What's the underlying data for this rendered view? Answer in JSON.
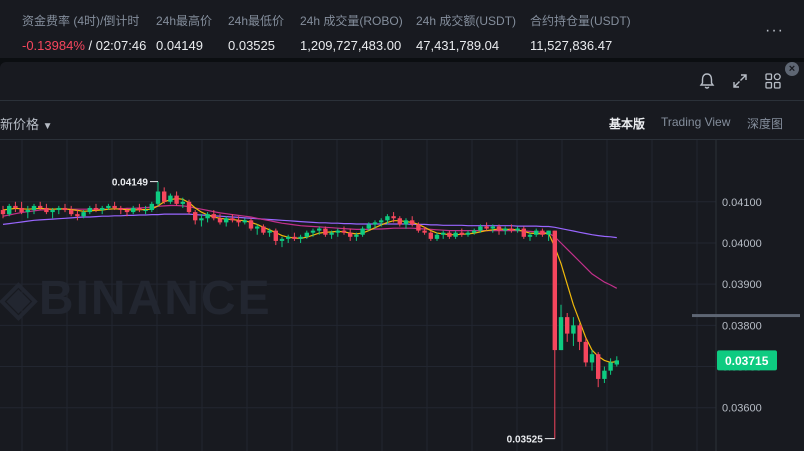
{
  "stats": [
    {
      "label": "资金费率 (4时)/倒计时",
      "value_part1": "-0.13984%",
      "value_part2": " / 02:07:46"
    },
    {
      "label": "24h最高价",
      "value": "0.04149"
    },
    {
      "label": "24h最低价",
      "value": "0.03525"
    },
    {
      "label": "24h 成交量(ROBO)",
      "value": "1,209,727,483.00"
    },
    {
      "label": "24h 成交额(USDT)",
      "value": "47,431,789.04"
    },
    {
      "label": "合约持仓量(USDT)",
      "value": "11,527,836.47"
    }
  ],
  "more_label": "···",
  "price_selector": "新价格",
  "view_tabs": [
    "基本版",
    "Trading View",
    "深度图"
  ],
  "watermark": "BINANCE",
  "chart_data": {
    "type": "candlestick",
    "y_ticks": [
      "0.04100",
      "0.04000",
      "0.03900",
      "0.03800",
      "0.03700",
      "0.03600"
    ],
    "y_tick_values": [
      0.041,
      0.04,
      0.039,
      0.038,
      0.037,
      0.036
    ],
    "ylim": [
      0.03495,
      0.0425
    ],
    "current_price": "0.03715",
    "high_label": "0.04149",
    "low_label": "0.03525",
    "colors": {
      "up": "#0ecb81",
      "down": "#f6465d",
      "ma_fast": "#f0b90b",
      "ma_mid": "#c2308b",
      "ma_slow": "#9966ff",
      "price_tag": "#0ecb81"
    },
    "candles": [
      [
        0.0408,
        0.0409,
        0.0406,
        0.0407
      ],
      [
        0.0407,
        0.04095,
        0.04065,
        0.0409
      ],
      [
        0.0409,
        0.041,
        0.04075,
        0.04085
      ],
      [
        0.04085,
        0.041,
        0.0407,
        0.04075
      ],
      [
        0.04075,
        0.0409,
        0.0406,
        0.0408
      ],
      [
        0.0408,
        0.04095,
        0.0407,
        0.0409
      ],
      [
        0.0409,
        0.041,
        0.0408,
        0.04085
      ],
      [
        0.04085,
        0.04095,
        0.0407,
        0.04075
      ],
      [
        0.04075,
        0.04085,
        0.0406,
        0.0408
      ],
      [
        0.0408,
        0.0409,
        0.0407,
        0.04085
      ],
      [
        0.04085,
        0.04095,
        0.04075,
        0.0408
      ],
      [
        0.0408,
        0.0409,
        0.04065,
        0.0407
      ],
      [
        0.0407,
        0.0408,
        0.04055,
        0.04065
      ],
      [
        0.04065,
        0.0408,
        0.0406,
        0.04075
      ],
      [
        0.04075,
        0.0409,
        0.0407,
        0.04085
      ],
      [
        0.04085,
        0.04095,
        0.04075,
        0.0408
      ],
      [
        0.0408,
        0.0409,
        0.0407,
        0.04085
      ],
      [
        0.04085,
        0.04095,
        0.0408,
        0.0409
      ],
      [
        0.0409,
        0.041,
        0.0408,
        0.04085
      ],
      [
        0.04085,
        0.0409,
        0.0407,
        0.0408
      ],
      [
        0.0408,
        0.04085,
        0.04065,
        0.04075
      ],
      [
        0.04075,
        0.0409,
        0.0407,
        0.04085
      ],
      [
        0.04085,
        0.04095,
        0.04075,
        0.0408
      ],
      [
        0.0408,
        0.0409,
        0.0407,
        0.0408
      ],
      [
        0.0408,
        0.041,
        0.04075,
        0.04095
      ],
      [
        0.04095,
        0.04149,
        0.0409,
        0.04125
      ],
      [
        0.04125,
        0.04135,
        0.04095,
        0.041
      ],
      [
        0.041,
        0.0412,
        0.04095,
        0.04115
      ],
      [
        0.04115,
        0.04125,
        0.0409,
        0.04095
      ],
      [
        0.04095,
        0.0411,
        0.04085,
        0.041
      ],
      [
        0.041,
        0.04105,
        0.0407,
        0.04075
      ],
      [
        0.04075,
        0.0408,
        0.04045,
        0.04055
      ],
      [
        0.04055,
        0.0407,
        0.0404,
        0.0406
      ],
      [
        0.0406,
        0.04075,
        0.0405,
        0.0407
      ],
      [
        0.0407,
        0.0408,
        0.04055,
        0.0406
      ],
      [
        0.0406,
        0.0407,
        0.04045,
        0.0405
      ],
      [
        0.0405,
        0.04065,
        0.0404,
        0.0406
      ],
      [
        0.0406,
        0.0407,
        0.0405,
        0.04055
      ],
      [
        0.04055,
        0.04065,
        0.0404,
        0.0405
      ],
      [
        0.0405,
        0.0406,
        0.04045,
        0.04055
      ],
      [
        0.04055,
        0.0406,
        0.0403,
        0.04035
      ],
      [
        0.04035,
        0.04045,
        0.0402,
        0.0404
      ],
      [
        0.0404,
        0.04045,
        0.0402,
        0.04025
      ],
      [
        0.04025,
        0.04035,
        0.04015,
        0.0403
      ],
      [
        0.0403,
        0.04035,
        0.03995,
        0.04005
      ],
      [
        0.04005,
        0.04015,
        0.0399,
        0.0401
      ],
      [
        0.0401,
        0.0402,
        0.04,
        0.04015
      ],
      [
        0.04015,
        0.04025,
        0.04005,
        0.0401
      ],
      [
        0.0401,
        0.0402,
        0.04,
        0.04015
      ],
      [
        0.04015,
        0.0403,
        0.0401,
        0.04025
      ],
      [
        0.04025,
        0.04035,
        0.04015,
        0.0403
      ],
      [
        0.0403,
        0.0404,
        0.0402,
        0.04035
      ],
      [
        0.04035,
        0.0404,
        0.04015,
        0.0402
      ],
      [
        0.0402,
        0.0403,
        0.0401,
        0.04025
      ],
      [
        0.04025,
        0.04035,
        0.04015,
        0.0403
      ],
      [
        0.0403,
        0.0404,
        0.0402,
        0.04025
      ],
      [
        0.04025,
        0.04035,
        0.04005,
        0.04015
      ],
      [
        0.04015,
        0.04025,
        0.04005,
        0.0402
      ],
      [
        0.0402,
        0.0404,
        0.04015,
        0.04035
      ],
      [
        0.04035,
        0.0405,
        0.0403,
        0.04045
      ],
      [
        0.04045,
        0.04055,
        0.04035,
        0.0405
      ],
      [
        0.0405,
        0.0406,
        0.0404,
        0.04055
      ],
      [
        0.04055,
        0.0407,
        0.04045,
        0.04065
      ],
      [
        0.04065,
        0.04075,
        0.0405,
        0.0406
      ],
      [
        0.0406,
        0.04065,
        0.0404,
        0.04045
      ],
      [
        0.04045,
        0.0406,
        0.04035,
        0.04055
      ],
      [
        0.04055,
        0.04065,
        0.0404,
        0.04045
      ],
      [
        0.04045,
        0.0405,
        0.04025,
        0.0403
      ],
      [
        0.0403,
        0.0404,
        0.0402,
        0.04025
      ],
      [
        0.04025,
        0.0403,
        0.04005,
        0.0401
      ],
      [
        0.0401,
        0.04025,
        0.04005,
        0.0402
      ],
      [
        0.0402,
        0.0403,
        0.0401,
        0.04025
      ],
      [
        0.04025,
        0.0403,
        0.0401,
        0.04015
      ],
      [
        0.04015,
        0.0403,
        0.0401,
        0.04025
      ],
      [
        0.04025,
        0.04035,
        0.04015,
        0.0402
      ],
      [
        0.0402,
        0.0403,
        0.04015,
        0.04025
      ],
      [
        0.04025,
        0.04035,
        0.0402,
        0.0403
      ],
      [
        0.0403,
        0.04045,
        0.04025,
        0.0404
      ],
      [
        0.0404,
        0.0405,
        0.0403,
        0.04035
      ],
      [
        0.04035,
        0.04045,
        0.04025,
        0.0404
      ],
      [
        0.0404,
        0.04045,
        0.0402,
        0.0403
      ],
      [
        0.0403,
        0.0404,
        0.0402,
        0.04035
      ],
      [
        0.04035,
        0.04045,
        0.04025,
        0.0403
      ],
      [
        0.0403,
        0.0404,
        0.04025,
        0.04035
      ],
      [
        0.04035,
        0.0404,
        0.0401,
        0.04015
      ],
      [
        0.04015,
        0.04025,
        0.04005,
        0.0402
      ],
      [
        0.0402,
        0.04035,
        0.04015,
        0.0403
      ],
      [
        0.0403,
        0.04035,
        0.04015,
        0.0402
      ],
      [
        0.0402,
        0.0403,
        0.04005,
        0.0403
      ],
      [
        0.0403,
        0.0403,
        0.03525,
        0.0374
      ],
      [
        0.0374,
        0.0385,
        0.0374,
        0.0382
      ],
      [
        0.0382,
        0.0383,
        0.0376,
        0.0378
      ],
      [
        0.0378,
        0.0382,
        0.0375,
        0.038
      ],
      [
        0.038,
        0.03805,
        0.0374,
        0.0376
      ],
      [
        0.0376,
        0.0377,
        0.037,
        0.0371
      ],
      [
        0.0371,
        0.0374,
        0.0369,
        0.0373
      ],
      [
        0.0373,
        0.03735,
        0.0365,
        0.0367
      ],
      [
        0.0367,
        0.037,
        0.0366,
        0.0369
      ],
      [
        0.0369,
        0.0372,
        0.0368,
        0.0371
      ],
      [
        0.03705,
        0.03725,
        0.037,
        0.03715
      ]
    ],
    "ma_fast": [
      0.0408,
      0.04082,
      0.04084,
      0.04083,
      0.04082,
      0.04083,
      0.04084,
      0.04083,
      0.04082,
      0.04083,
      0.04083,
      0.04081,
      0.04079,
      0.04077,
      0.04078,
      0.04079,
      0.0408,
      0.04082,
      0.04083,
      0.04082,
      0.04081,
      0.0408,
      0.04081,
      0.04081,
      0.04082,
      0.0409,
      0.041,
      0.04105,
      0.04108,
      0.04106,
      0.04098,
      0.04085,
      0.04075,
      0.04068,
      0.04063,
      0.0406,
      0.04058,
      0.04057,
      0.04055,
      0.04054,
      0.0405,
      0.04045,
      0.04038,
      0.04032,
      0.04025,
      0.04018,
      0.04014,
      0.04012,
      0.04011,
      0.04014,
      0.04019,
      0.04024,
      0.04026,
      0.04027,
      0.04028,
      0.04027,
      0.04024,
      0.04022,
      0.04024,
      0.0403,
      0.04037,
      0.04044,
      0.0405,
      0.04054,
      0.04054,
      0.04052,
      0.0405,
      0.04045,
      0.04038,
      0.0403,
      0.04024,
      0.04022,
      0.0402,
      0.0402,
      0.04021,
      0.04022,
      0.04024,
      0.04027,
      0.0403,
      0.04032,
      0.04034,
      0.04033,
      0.04033,
      0.04032,
      0.04028,
      0.04024,
      0.04023,
      0.04022,
      0.04024,
      0.0399,
      0.0395,
      0.039,
      0.0385,
      0.0381,
      0.0377,
      0.0374,
      0.03725,
      0.03715,
      0.0371,
      0.03712
    ],
    "ma_mid": [
      0.04065,
      0.04068,
      0.04071,
      0.04074,
      0.04076,
      0.04078,
      0.0408,
      0.04081,
      0.04082,
      0.04082,
      0.04082,
      0.04082,
      0.04082,
      0.04082,
      0.04082,
      0.04082,
      0.04082,
      0.04082,
      0.04083,
      0.04083,
      0.04084,
      0.04084,
      0.04085,
      0.04086,
      0.04087,
      0.04089,
      0.0409,
      0.04091,
      0.04091,
      0.0409,
      0.04088,
      0.04085,
      0.04082,
      0.04079,
      0.04076,
      0.04073,
      0.04071,
      0.04069,
      0.04067,
      0.04065,
      0.04063,
      0.0406,
      0.04057,
      0.04054,
      0.04051,
      0.04048,
      0.04046,
      0.04044,
      0.04042,
      0.04041,
      0.0404,
      0.04039,
      0.04038,
      0.04037,
      0.04036,
      0.04035,
      0.04034,
      0.04033,
      0.04033,
      0.04033,
      0.04034,
      0.04034,
      0.04035,
      0.04036,
      0.04036,
      0.04036,
      0.04036,
      0.04035,
      0.04034,
      0.04033,
      0.04032,
      0.04031,
      0.0403,
      0.0403,
      0.0403,
      0.0403,
      0.0403,
      0.0403,
      0.0403,
      0.0403,
      0.0403,
      0.0403,
      0.0403,
      0.0403,
      0.04029,
      0.04028,
      0.04027,
      0.04026,
      0.04024,
      0.04015,
      0.04,
      0.03985,
      0.0397,
      0.03955,
      0.0394,
      0.03925,
      0.03915,
      0.03905,
      0.03898,
      0.0389
    ],
    "ma_slow": [
      0.04045,
      0.04047,
      0.04049,
      0.04051,
      0.04053,
      0.04055,
      0.04056,
      0.04057,
      0.04058,
      0.04059,
      0.0406,
      0.04061,
      0.04062,
      0.04063,
      0.04063,
      0.04064,
      0.04065,
      0.04065,
      0.04066,
      0.04066,
      0.04067,
      0.04067,
      0.04068,
      0.04068,
      0.04069,
      0.04069,
      0.0407,
      0.0407,
      0.0407,
      0.0407,
      0.0407,
      0.04069,
      0.04068,
      0.04067,
      0.04066,
      0.04065,
      0.04064,
      0.04063,
      0.04062,
      0.04061,
      0.0406,
      0.04059,
      0.04058,
      0.04057,
      0.04056,
      0.04055,
      0.04054,
      0.04053,
      0.04052,
      0.04051,
      0.0405,
      0.04049,
      0.04049,
      0.04048,
      0.04048,
      0.04047,
      0.04047,
      0.04046,
      0.04046,
      0.04046,
      0.04046,
      0.04046,
      0.04046,
      0.04046,
      0.04046,
      0.04046,
      0.04045,
      0.04045,
      0.04045,
      0.04044,
      0.04044,
      0.04043,
      0.04043,
      0.04043,
      0.04043,
      0.04042,
      0.04042,
      0.04042,
      0.04042,
      0.04042,
      0.04042,
      0.04042,
      0.04042,
      0.04041,
      0.04041,
      0.04041,
      0.04041,
      0.0404,
      0.0404,
      0.04038,
      0.04035,
      0.04032,
      0.04029,
      0.04026,
      0.04023,
      0.0402,
      0.04018,
      0.04016,
      0.04015,
      0.04013
    ]
  }
}
